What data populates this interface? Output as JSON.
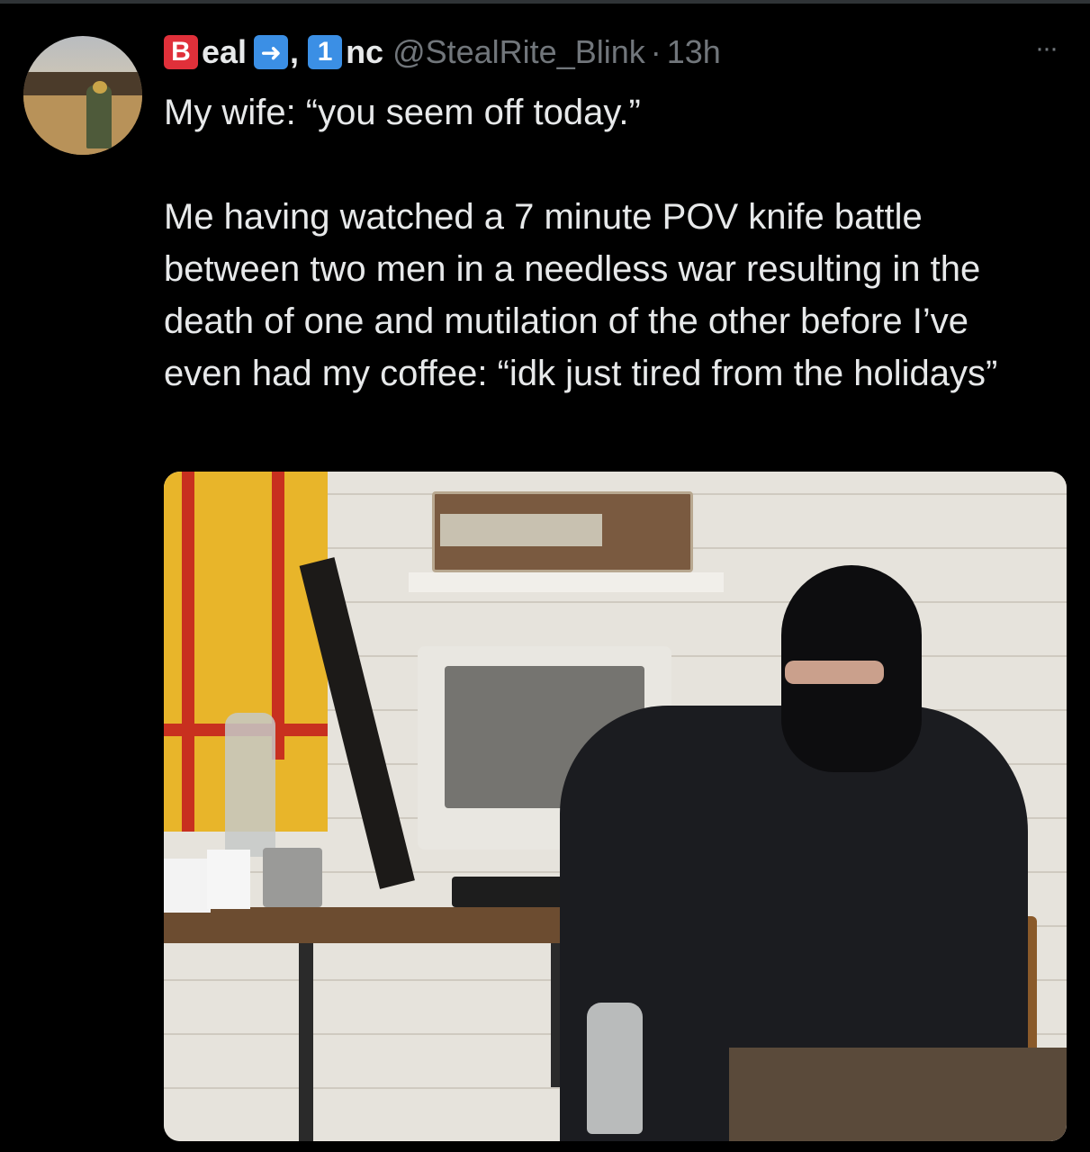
{
  "tweet": {
    "author": {
      "name_b": "B",
      "name_part1": "eal",
      "name_arrow": "➜",
      "name_comma": ",",
      "name_one": "1",
      "name_part2": "nc",
      "handle": "@StealRite_Blink",
      "separator": "·",
      "time": "13h"
    },
    "more_label": "···",
    "lines": [
      "My wife: “you seem off today.”",
      "Me having watched a 7 minute POV knife battle between two men in a needless war resulting in the death of one and mutilation of the other before I’ve even had my coffee: “idk just tired from the holidays”"
    ]
  }
}
